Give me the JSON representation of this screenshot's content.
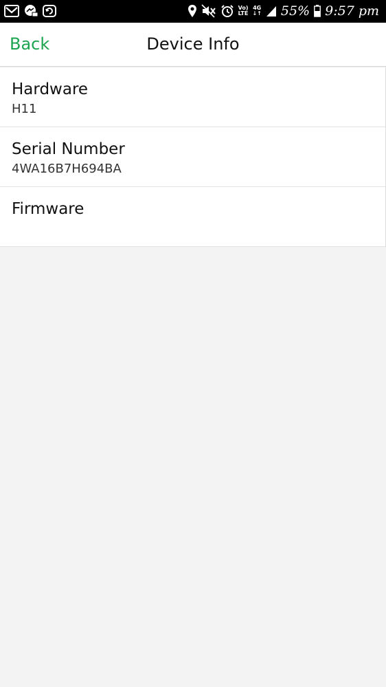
{
  "status_bar": {
    "left_icons": [
      "gmail-icon",
      "messenger-icon",
      "sync-icon"
    ],
    "right_icons": [
      "location-icon",
      "mute-icon",
      "alarm-icon",
      "volte-icon",
      "network-4g-icon",
      "signal-icon",
      "battery-icon"
    ],
    "volte_top": "Vo)",
    "volte_bottom": "LTE",
    "network_top": "4G",
    "network_bottom": "↓↑",
    "battery_percent": "55%",
    "time": "9:57 pm"
  },
  "nav": {
    "back_label": "Back",
    "title": "Device Info"
  },
  "rows": [
    {
      "label": "Hardware",
      "value": "H11"
    },
    {
      "label": "Serial Number",
      "value": "4WA16B7H694BA"
    },
    {
      "label": "Firmware",
      "value": ""
    }
  ],
  "colors": {
    "accent": "#1ea450",
    "background": "#f3f3f3",
    "status_bar": "#000000"
  }
}
